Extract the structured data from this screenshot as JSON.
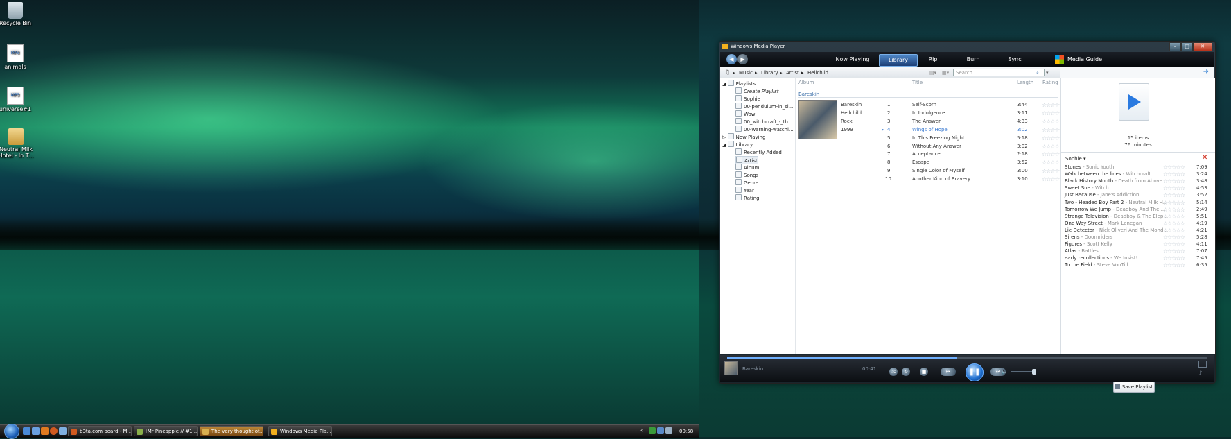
{
  "desktop": {
    "icons": [
      {
        "label": "Recycle Bin",
        "icon": "recycle-bin-icon"
      },
      {
        "label": "animals",
        "icon": "mp3-file-icon"
      },
      {
        "label": "universe#1",
        "icon": "mp3-file-icon"
      },
      {
        "label": "Neutral Milk Hotel - In T...",
        "icon": "folder-icon"
      }
    ]
  },
  "taskbar": {
    "buttons": [
      {
        "label": "b3ta.com board - M..."
      },
      {
        "label": "[Mr Pineapple // #1..."
      },
      {
        "label": "The very thought of..."
      },
      {
        "label": "Windows Media Pla..."
      }
    ],
    "clock": "00:58"
  },
  "wmp": {
    "title": "Windows Media Player",
    "tabs": [
      {
        "label": "Now Playing"
      },
      {
        "label": "Library"
      },
      {
        "label": "Rip"
      },
      {
        "label": "Burn"
      },
      {
        "label": "Sync"
      },
      {
        "label": "Media Guide"
      }
    ],
    "breadcrumb": [
      "Music",
      "Library",
      "Artist",
      "Hellchild"
    ],
    "search_placeholder": "Search",
    "tree": [
      {
        "label": "Playlists"
      },
      {
        "label": "Create Playlist"
      },
      {
        "label": "Sophie"
      },
      {
        "label": "00-pendulum-in_si..."
      },
      {
        "label": "Wow"
      },
      {
        "label": "00_witchcraft_-_th..."
      },
      {
        "label": "00-warning-watchi..."
      },
      {
        "label": "Now Playing"
      },
      {
        "label": "Library"
      },
      {
        "label": "Recently Added"
      },
      {
        "label": "Artist"
      },
      {
        "label": "Album"
      },
      {
        "label": "Songs"
      },
      {
        "label": "Genre"
      },
      {
        "label": "Year"
      },
      {
        "label": "Rating"
      }
    ],
    "columns": {
      "album": "Album",
      "title": "Title",
      "length": "Length",
      "rating": "Rating"
    },
    "album": {
      "group": "Bareskin",
      "name": "Bareskin",
      "artist": "Hellchild",
      "genre": "Rock",
      "year": "1999"
    },
    "tracks": [
      {
        "num": "1",
        "title": "Self-Scorn",
        "length": "3:44"
      },
      {
        "num": "2",
        "title": "In Indulgence",
        "length": "3:11"
      },
      {
        "num": "3",
        "title": "The Answer",
        "length": "4:33"
      },
      {
        "num": "4",
        "title": "Wings of Hope",
        "length": "3:02"
      },
      {
        "num": "5",
        "title": "In This Freezing Night",
        "length": "5:18"
      },
      {
        "num": "6",
        "title": "Without Any Answer",
        "length": "3:02"
      },
      {
        "num": "7",
        "title": "Acceptance",
        "length": "2:18"
      },
      {
        "num": "8",
        "title": "Escape",
        "length": "3:52"
      },
      {
        "num": "9",
        "title": "Single Color of Myself",
        "length": "3:00"
      },
      {
        "num": "10",
        "title": "Another Kind of Bravery",
        "length": "3:10"
      }
    ],
    "playing_track": 3,
    "list_pane": {
      "items_count": "15 items",
      "duration": "76 minutes",
      "playlist_name": "Sophie",
      "save_label": "Save Playlist",
      "songs": [
        {
          "title": "Stones",
          "artist": "Sonic Youth",
          "length": "7:09"
        },
        {
          "title": "Walk between the lines",
          "artist": "Witchcraft",
          "length": "3:24"
        },
        {
          "title": "Black History Month",
          "artist": "Death from Above ...",
          "length": "3:48"
        },
        {
          "title": "Sweet Sue",
          "artist": "Witch",
          "length": "4:53"
        },
        {
          "title": "Just Because",
          "artist": "Jane's Addiction",
          "length": "3:52"
        },
        {
          "title": "Two - Headed Boy Part 2",
          "artist": "Neutral Milk H...",
          "length": "5:14"
        },
        {
          "title": "Tomorrow We Jump",
          "artist": "Deadboy And The ...",
          "length": "2:49"
        },
        {
          "title": "Strange Television",
          "artist": "Deadboy & The Elep...",
          "length": "5:51"
        },
        {
          "title": "One Way Street",
          "artist": "Mark Lanegan",
          "length": "4:19"
        },
        {
          "title": "Lie Detector",
          "artist": "Nick Oliveri And The Mond...",
          "length": "4:21"
        },
        {
          "title": "Sirens",
          "artist": "Doomriders",
          "length": "5:28"
        },
        {
          "title": "Figures",
          "artist": "Scott Kelly",
          "length": "4:11"
        },
        {
          "title": "Atlas",
          "artist": "Battles",
          "length": "7:07"
        },
        {
          "title": "early recollections",
          "artist": "We Insist!",
          "length": "7:45"
        },
        {
          "title": "To the Field",
          "artist": "Steve VonTill",
          "length": "6:35"
        }
      ]
    },
    "controls": {
      "now_playing_label": "Bareskin",
      "time": "00:41",
      "seek_progress": 0.48
    }
  }
}
